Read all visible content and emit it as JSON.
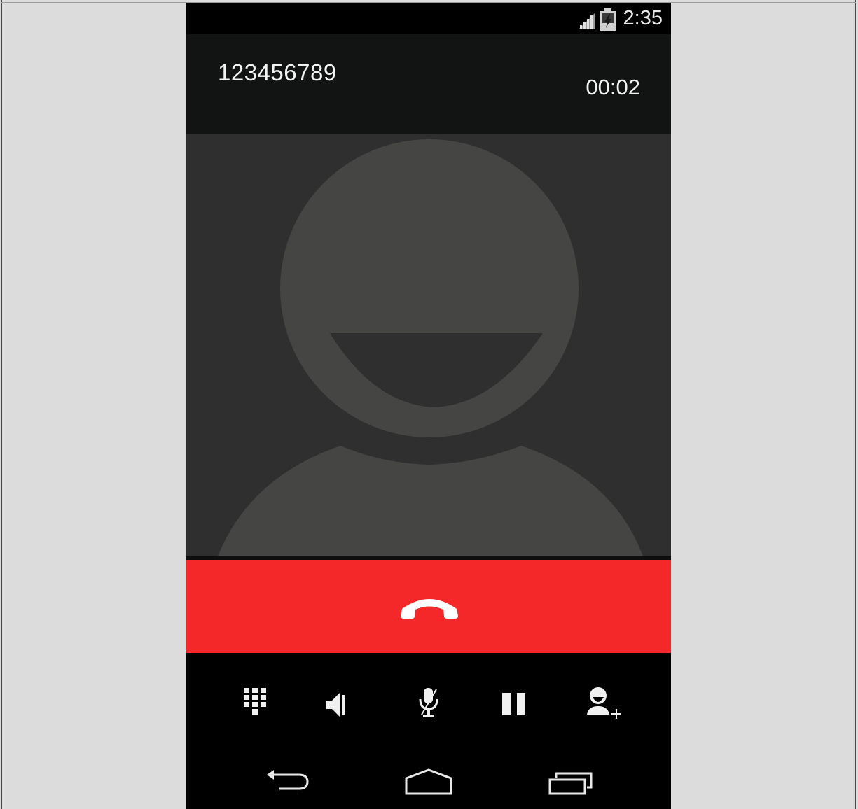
{
  "status_bar": {
    "time": "2:35",
    "signal_icon": "signal-bars-icon",
    "battery_icon": "battery-charging-icon"
  },
  "call": {
    "number": "123456789",
    "duration": "00:02"
  },
  "contact_photo": {
    "icon": "default-contact-avatar-icon"
  },
  "end_call": {
    "icon": "end-call-handset-icon",
    "color": "#f52829"
  },
  "controls": [
    {
      "name": "dialpad",
      "icon": "dialpad-icon"
    },
    {
      "name": "speaker",
      "icon": "speaker-icon"
    },
    {
      "name": "mute",
      "icon": "mute-microphone-icon"
    },
    {
      "name": "hold",
      "icon": "pause-icon"
    },
    {
      "name": "add-call",
      "icon": "add-person-icon"
    }
  ],
  "navigation": [
    {
      "name": "back",
      "icon": "back-icon"
    },
    {
      "name": "home",
      "icon": "home-icon"
    },
    {
      "name": "recent-apps",
      "icon": "recent-apps-icon"
    }
  ],
  "colors": {
    "header_bg": "#111412",
    "photo_bg": "#2f2f2f",
    "avatar_fill": "#454644",
    "text": "#f2f2f2"
  }
}
